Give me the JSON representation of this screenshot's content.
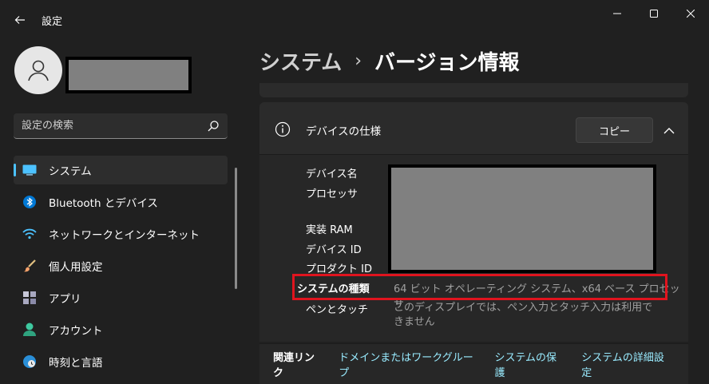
{
  "window": {
    "title": "設定",
    "back_icon": "arrow-left-icon",
    "controls": [
      "minimize-icon",
      "maximize-icon",
      "close-icon"
    ]
  },
  "sidebar": {
    "search_placeholder": "設定の検索",
    "items": [
      {
        "label": "システム",
        "icon": "system-icon",
        "active": true
      },
      {
        "label": "Bluetooth とデバイス",
        "icon": "bluetooth-icon"
      },
      {
        "label": "ネットワークとインターネット",
        "icon": "wifi-icon"
      },
      {
        "label": "個人用設定",
        "icon": "brush-icon"
      },
      {
        "label": "アプリ",
        "icon": "apps-icon"
      },
      {
        "label": "アカウント",
        "icon": "account-icon"
      },
      {
        "label": "時刻と言語",
        "icon": "globe-clock-icon"
      }
    ]
  },
  "breadcrumb": {
    "parent": "システム",
    "separator": "›",
    "current": "バージョン情報"
  },
  "device_spec": {
    "title": "デバイスの仕様",
    "copy_label": "コピー",
    "rows": [
      {
        "label": "デバイス名",
        "value": ""
      },
      {
        "label": "プロセッサ",
        "value": ""
      },
      {
        "label": "実装 RAM",
        "value": ""
      },
      {
        "label": "デバイス ID",
        "value": ""
      },
      {
        "label": "プロダクト ID",
        "value": ""
      },
      {
        "label": "システムの種類",
        "value": "64 ビット オペレーティング システム、x64 ベース プロセッサ"
      },
      {
        "label": "ペンとタッチ",
        "value": "このディスプレイでは、ペン入力とタッチ入力は利用できません"
      }
    ]
  },
  "related": {
    "title": "関連リンク",
    "links": [
      "ドメインまたはワークグループ",
      "システムの保護",
      "システムの詳細設定"
    ]
  },
  "colors": {
    "accent": "#4cc2ff",
    "link": "#99ebff",
    "highlight": "#e0141e",
    "background": "#202020"
  }
}
